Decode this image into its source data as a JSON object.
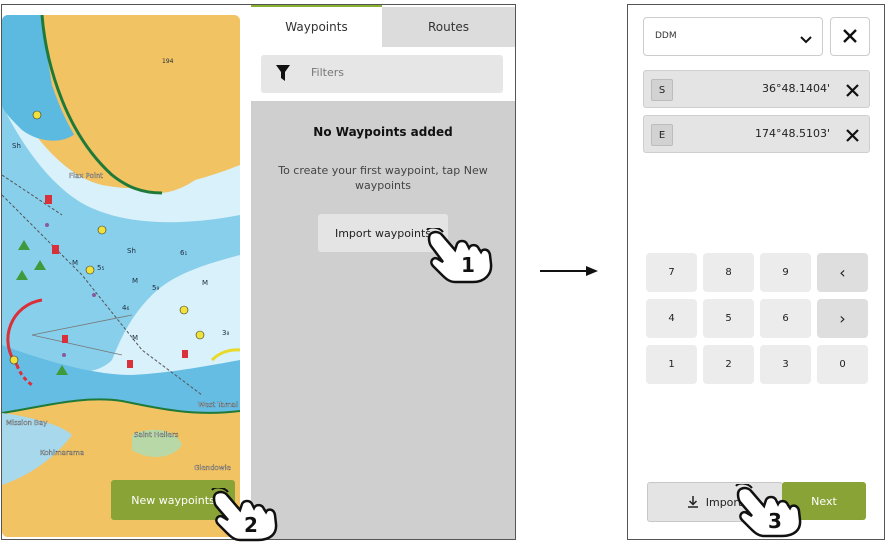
{
  "tabs": {
    "waypoints": "Waypoints",
    "routes": "Routes"
  },
  "filter": {
    "placeholder": "Filters",
    "icon": "funnel-icon"
  },
  "empty_state": {
    "title": "No Waypoints added",
    "desc": "To create your first waypoint, tap New waypoints"
  },
  "buttons": {
    "import_waypoints": "Import waypoints",
    "new_waypoints": "New waypoints",
    "import": "Import",
    "next": "Next"
  },
  "map_labels": {
    "depth_194": "194",
    "flax_point": "Flax Point",
    "mission_bay": "Mission Bay",
    "saint_heliers": "Saint Heliers",
    "kohimarama": "Kohimarama",
    "glendowie": "Glendowie",
    "west_tamaki": "West Tamal",
    "sh": "Sh",
    "m": "M",
    "depth_5a": "5₅",
    "depth_5b": "5₉",
    "depth_3": "3₈",
    "depth_4": "4₆",
    "depth_6": "6₁"
  },
  "annotations": {
    "step1": "1",
    "step2": "2",
    "step3": "3"
  },
  "coordinate_form": {
    "format": "DDM",
    "rows": [
      {
        "hemisphere": "S",
        "value": "36°48.1404'"
      },
      {
        "hemisphere": "E",
        "value": "174°48.5103'"
      }
    ]
  },
  "keypad": {
    "rows": [
      [
        "7",
        "8",
        "9",
        "‹"
      ],
      [
        "4",
        "5",
        "6",
        "›"
      ],
      [
        "1",
        "2",
        "3",
        "0"
      ]
    ]
  },
  "colors": {
    "accent": "#8aa336",
    "land": "#f2bf5e",
    "shallow": "#6ec6e8",
    "deep": "#cfeef8"
  }
}
